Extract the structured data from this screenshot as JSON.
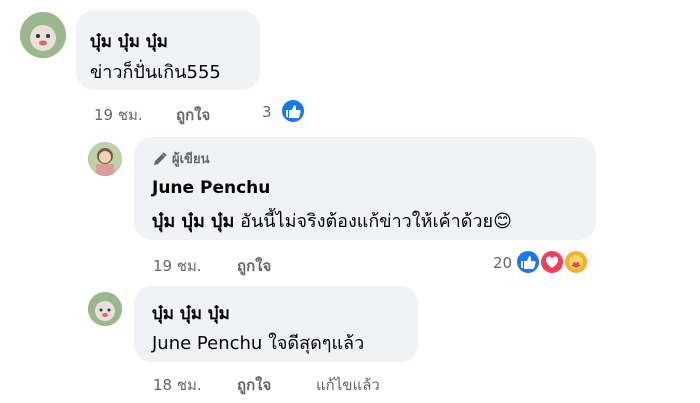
{
  "comments": [
    {
      "author": "บุ๋ม บุ๋ม บุ๋ม",
      "text": "ข่าวก็ปั่นเกิน555",
      "time": "19 ชม.",
      "like_label": "ถูกใจ",
      "reaction_count": "3",
      "reactions": [
        "like"
      ]
    },
    {
      "badge": "ผู้เขียน",
      "author": "June Penchu",
      "mention": "บุ๋ม บุ๋ม บุ๋ม",
      "text": "อันนี้ไม่จริงต้องแก้ข่าวให้เค้าด้วย",
      "emoji": "😊",
      "time": "19 ชม.",
      "like_label": "ถูกใจ",
      "reaction_count": "20",
      "reactions": [
        "like",
        "love",
        "care"
      ]
    },
    {
      "author": "บุ๋ม บุ๋ม บุ๋ม",
      "mention": "June Penchu",
      "text": "ใจดีสุดๆแล้ว",
      "time": "18 ชม.",
      "like_label": "ถูกใจ",
      "edited_label": "แก้ไขแล้ว"
    }
  ],
  "colors": {
    "bubble": "#f0f2f5",
    "like": "#1877f2",
    "love": "#f33e58",
    "care": "#f7b125",
    "meta": "#65676b"
  }
}
